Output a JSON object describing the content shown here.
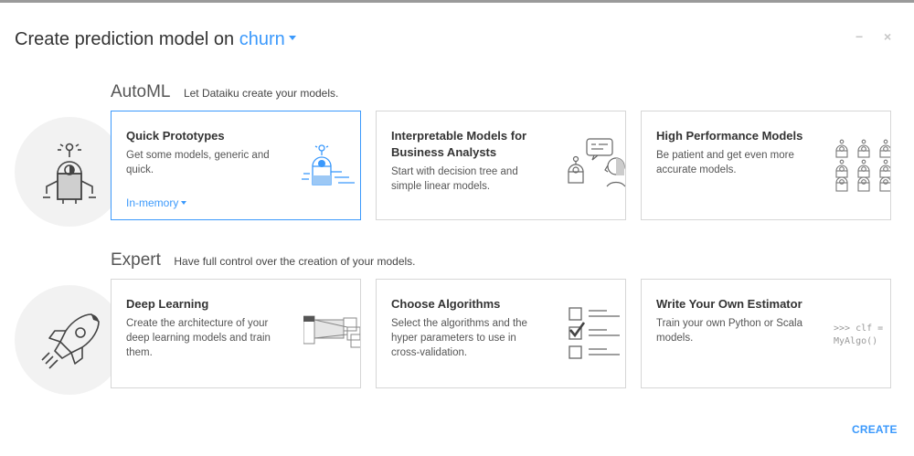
{
  "dialog": {
    "title_prefix": "Create prediction model on",
    "dataset_name": "churn",
    "minimize_glyph": "−",
    "close_glyph": "×",
    "create_label": "CREATE"
  },
  "automl": {
    "heading": "AutoML",
    "subheading": "Let Dataiku create your models.",
    "cards": [
      {
        "title": "Quick Prototypes",
        "description": "Get some models, generic and quick.",
        "engine_label": "In-memory",
        "icon": "quick-prototype-icon"
      },
      {
        "title": "Interpretable Models for Business Analysts",
        "description": "Start with decision tree and simple linear models.",
        "icon": "interpretable-models-icon"
      },
      {
        "title": "High Performance Models",
        "description": "Be patient and get even more accurate models.",
        "icon": "robot-grid-icon"
      }
    ]
  },
  "expert": {
    "heading": "Expert",
    "subheading": "Have full control over the creation of your models.",
    "cards": [
      {
        "title": "Deep Learning",
        "description": "Create the architecture of your deep learning models and train them.",
        "icon": "neural-layers-icon"
      },
      {
        "title": "Choose Algorithms",
        "description": "Select the algorithms and the hyper parameters to use in cross-validation.",
        "icon": "checklist-icon"
      },
      {
        "title": "Write Your Own Estimator",
        "description": "Train your own Python or Scala models.",
        "code_line_1": ">>> clf =",
        "code_line_2": "MyAlgo()",
        "icon": "code-icon"
      }
    ]
  },
  "colors": {
    "accent": "#3b99fc",
    "border": "#d6d6d6",
    "circle_bg": "#f2f2f2"
  }
}
